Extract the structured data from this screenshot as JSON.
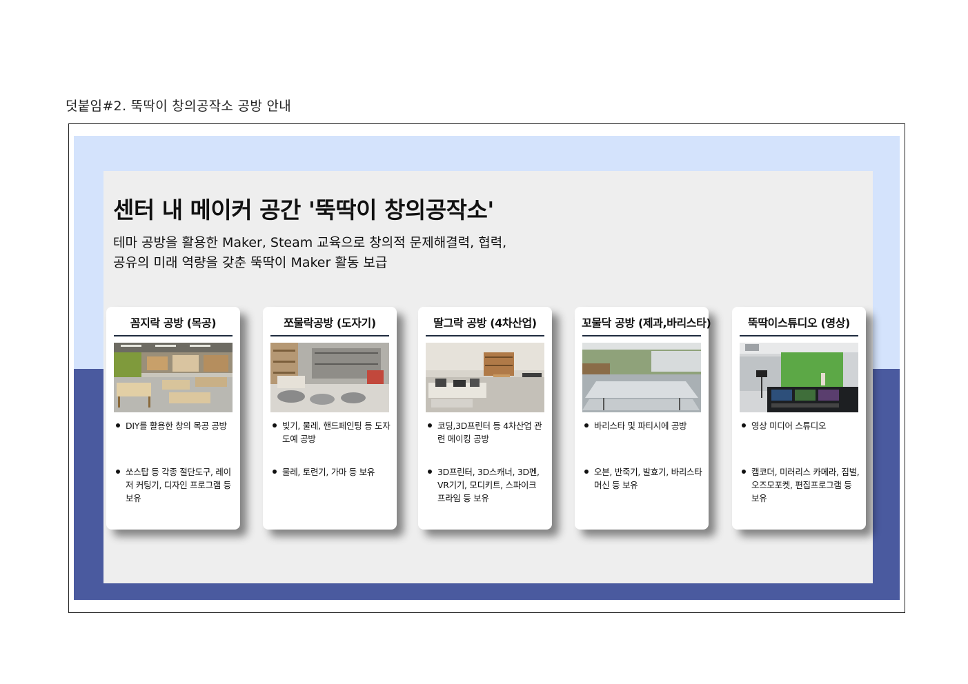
{
  "caption": "덧붙임#2. 뚝딱이 창의공작소 공방 안내",
  "title": "센터 내 메이커 공간 '뚝딱이 창의공작소'",
  "subtitle_lines": [
    "테마 공방을 활용한 Maker, Steam 교육으로 창의적 문제해결력, 협력,",
    "공유의 미래 역량을 갖춘 뚝딱이 Maker  활동 보급"
  ],
  "colors": {
    "top_band": "#d4e3fc",
    "bottom_band": "#4a5a9f",
    "panel": "#eeeeee",
    "rule": "#1e2a3e"
  },
  "cards": [
    {
      "title": "꼼지락 공방 (목공)",
      "photo": "woodworking-room-photo",
      "bullet1": "DIY를 활용한 창의 목공 공방",
      "bullet2": "쏘스탑 등 각종 절단도구, 레이저 커팅기, 디자인 프로그램 등 보유"
    },
    {
      "title": "쪼물락공방 (도자기)",
      "photo": "ceramics-room-photo",
      "bullet1": "빚기, 물레, 핸드페인팅 등 도자도예 공방",
      "bullet2": "물레, 토련기, 가마 등 보유"
    },
    {
      "title": "딸그락 공방 (4차산업)",
      "photo": "tech-lab-photo",
      "bullet1": "코딩,3D프린터 등 4차산업 관련 메이킹 공방",
      "bullet2": "3D프린터, 3D스캐너, 3D펜, VR기기, 모디키트, 스파이크 프라임 등 보유"
    },
    {
      "title": "꼬물닥 공방 (제과,바리스타)",
      "photo": "bakery-room-photo",
      "bullet1": "바리스타 및 파티시에 공방",
      "bullet2": "오븐, 반죽기, 발효기, 바리스타 머신 등 보유"
    },
    {
      "title": "뚝딱이스튜디오 (영상)",
      "photo": "video-studio-photo",
      "bullet1": "영상 미디어 스튜디오",
      "bullet2": "캠코더, 미러리스 카메라, 짐벌, 오즈모포켓, 편집프로그램 등 보유"
    }
  ]
}
